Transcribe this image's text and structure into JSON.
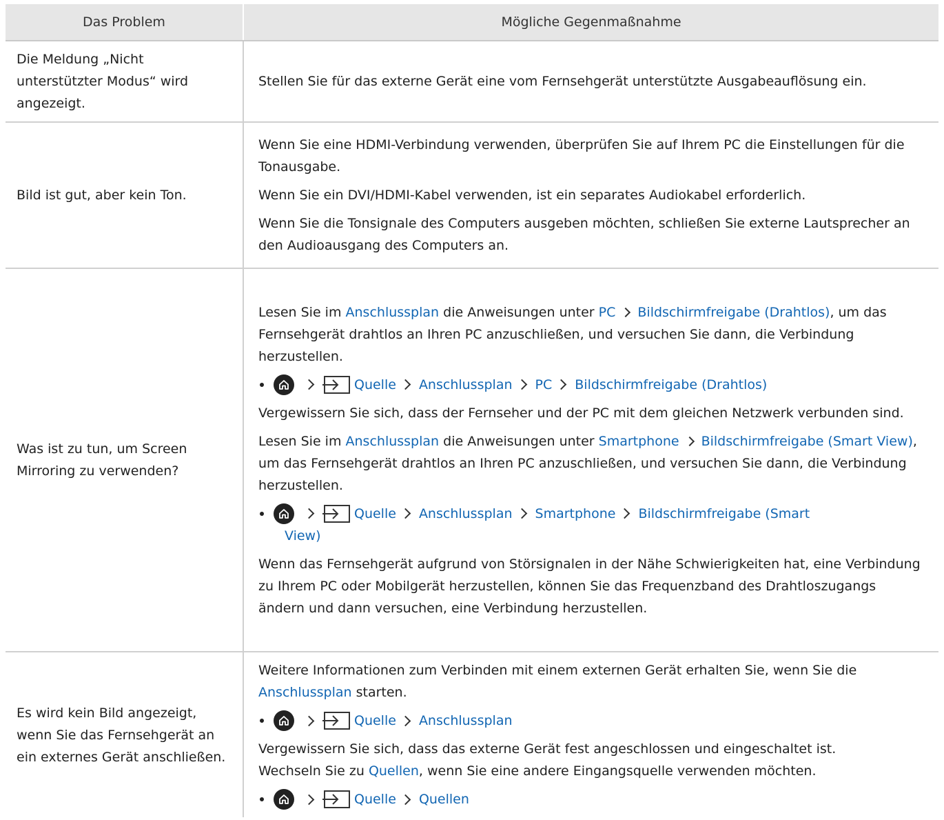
{
  "header": {
    "col1": "Das Problem",
    "col2": "Mögliche Gegenmaßnahme"
  },
  "rows": [
    {
      "problem": "Die Meldung „Nicht unterstützter Modus“ wird angezeigt.",
      "solution_p1": "Stellen Sie für das externe Gerät eine vom Fernsehgerät unterstützte Ausgabeauflösung ein."
    },
    {
      "problem": "Bild ist gut, aber kein Ton.",
      "solution_p1": "Wenn Sie eine HDMI-Verbindung verwenden, überprüfen Sie auf Ihrem PC die Einstellungen für die Tonausgabe.",
      "solution_p2": "Wenn Sie ein DVI/HDMI-Kabel verwenden, ist ein separates Audiokabel erforderlich.",
      "solution_p3": "Wenn Sie die Tonsignale des Computers ausgeben möchten, schließen Sie externe Lautsprecher an den Audioausgang des Computers an."
    },
    {
      "problem": "Was ist zu tun, um Screen Mirroring zu verwenden?",
      "p1_a": "Lesen Sie im ",
      "p1_link1": "Anschlussplan",
      "p1_b": " die Anweisungen unter ",
      "p1_link2": "PC",
      "p1_link3": "Bildschirmfreigabe (Drahtlos)",
      "p1_c": ", um das Fernsehgerät drahtlos an Ihren PC anzuschließen, und versuchen Sie dann, die Verbindung herzustellen.",
      "path1": [
        "Quelle",
        "Anschlussplan",
        "PC",
        "Bildschirmfreigabe (Drahtlos)"
      ],
      "p2": "Vergewissern Sie sich, dass der Fernseher und der PC mit dem gleichen Netzwerk verbunden sind.",
      "p3_a": "Lesen Sie im ",
      "p3_link1": "Anschlussplan",
      "p3_b": " die Anweisungen unter ",
      "p3_link2": "Smartphone",
      "p3_link3": "Bildschirmfreigabe (Smart View)",
      "p3_c": ", um das Fernsehgerät drahtlos an Ihren PC anzuschließen, und versuchen Sie dann, die Verbindung herzustellen.",
      "path2": [
        "Quelle",
        "Anschlussplan",
        "Smartphone",
        "Bildschirmfreigabe (Smart",
        "View)"
      ],
      "p4": "Wenn das Fernsehgerät aufgrund von Störsignalen in der Nähe Schwierigkeiten hat, eine Verbindung zu Ihrem PC oder Mobilgerät herzustellen, können Sie das Frequenzband des Drahtloszugangs ändern und dann versuchen, eine Verbindung herzustellen."
    },
    {
      "problem": "Es wird kein Bild angezeigt, wenn Sie das Fernsehgerät an ein externes Gerät anschließen.",
      "p1_a": "Weitere Informationen zum Verbinden mit einem externen Gerät erhalten Sie, wenn Sie die ",
      "p1_link": "Anschlussplan",
      "p1_b": " starten.",
      "path1": [
        "Quelle",
        "Anschlussplan"
      ],
      "p2": "Vergewissern Sie sich, dass das externe Gerät fest angeschlossen und eingeschaltet ist.",
      "p3_a": "Wechseln Sie zu ",
      "p3_link": "Quellen",
      "p3_b": ", wenn Sie eine andere Eingangsquelle verwenden möchten.",
      "path2": [
        "Quelle",
        "Quellen"
      ]
    }
  ],
  "colors": {
    "link": "#1266b3",
    "header_bg": "#e6e6e6",
    "border": "#d0d0d0"
  },
  "icons": [
    "home-icon",
    "source-icon",
    "chevron-right-icon",
    "bullet-icon"
  ]
}
